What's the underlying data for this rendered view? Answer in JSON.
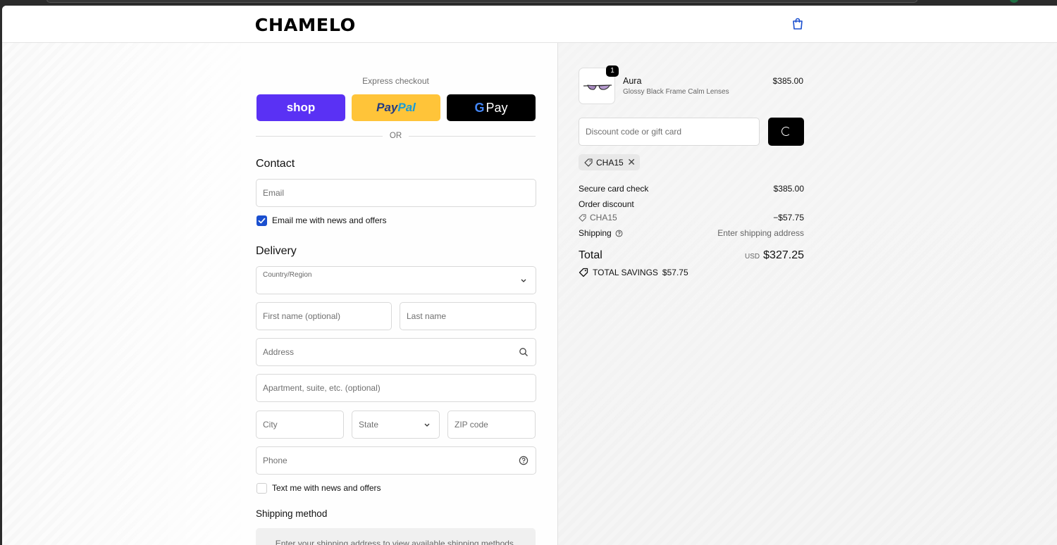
{
  "brand": {
    "logo": "CHAMELO"
  },
  "express": {
    "label": "Express checkout",
    "shop_label": "shop",
    "paypal_a": "Pay",
    "paypal_b": "Pal",
    "gpay_g": "G",
    "gpay_label": "Pay",
    "or": "OR"
  },
  "contact": {
    "title": "Contact",
    "email_placeholder": "Email",
    "news_checkbox_label": "Email me with news and offers",
    "news_checked": true
  },
  "delivery": {
    "title": "Delivery",
    "country_label": "Country/Region",
    "first_name_placeholder": "First name (optional)",
    "last_name_placeholder": "Last name",
    "address_placeholder": "Address",
    "apartment_placeholder": "Apartment, suite, etc. (optional)",
    "city_placeholder": "City",
    "state_placeholder": "State",
    "zip_placeholder": "ZIP code",
    "phone_placeholder": "Phone",
    "text_checkbox_label": "Text me with news and offers",
    "text_checked": false
  },
  "shipping_method": {
    "title": "Shipping method",
    "message": "Enter your shipping address to view available shipping methods."
  },
  "order": {
    "item": {
      "quantity": "1",
      "name": "Aura",
      "variant": "Glossy Black Frame Calm Lenses",
      "price": "$385.00"
    },
    "discount_placeholder": "Discount code or gift card",
    "applied_code": "CHA15",
    "summary": {
      "subtotal_label": "Secure card check",
      "subtotal_value": "$385.00",
      "order_discount_label": "Order discount",
      "discount_code": "CHA15",
      "discount_value": "−$57.75",
      "shipping_label": "Shipping",
      "shipping_value": "Enter shipping address"
    },
    "total": {
      "label": "Total",
      "currency": "USD",
      "value": "$327.25"
    },
    "savings": {
      "label": "TOTAL SAVINGS",
      "value": "$57.75"
    }
  },
  "colors": {
    "shop_purple": "#5a31f4",
    "paypal_yellow": "#ffc439",
    "checkbox_blue": "#1a4fcf"
  }
}
